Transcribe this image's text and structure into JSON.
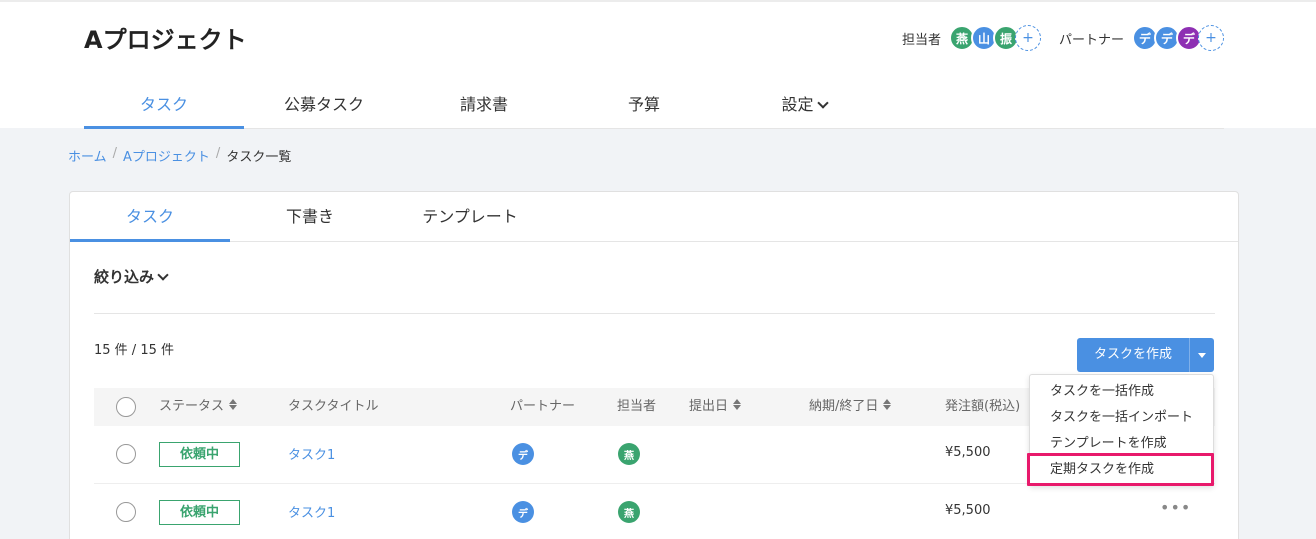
{
  "header": {
    "project_title": "Aプロジェクト",
    "assignee_label": "担当者",
    "partner_label": "パートナー",
    "assignees": [
      {
        "initial": "燕",
        "color": "#3aa46f"
      },
      {
        "initial": "山",
        "color": "#4a90e2"
      },
      {
        "initial": "振",
        "color": "#3aa46f"
      }
    ],
    "partners": [
      {
        "initial": "デ",
        "color": "#4a90e2"
      },
      {
        "initial": "デ",
        "color": "#4a90e2"
      },
      {
        "initial": "デ",
        "color": "#8e2fb3"
      }
    ],
    "add_symbol": "+"
  },
  "nav": {
    "items": [
      {
        "label": "タスク",
        "active": true
      },
      {
        "label": "公募タスク"
      },
      {
        "label": "請求書"
      },
      {
        "label": "予算"
      },
      {
        "label": "設定"
      }
    ]
  },
  "breadcrumb": {
    "home": "ホーム",
    "project": "Aプロジェクト",
    "current": "タスク一覧",
    "separator": "/"
  },
  "tabs": [
    {
      "label": "タスク",
      "active": true
    },
    {
      "label": "下書き"
    },
    {
      "label": "テンプレート"
    }
  ],
  "filter": {
    "label": "絞り込み"
  },
  "count": "15 件 / 15 件",
  "create": {
    "label": "タスクを作成",
    "menu": [
      "タスクを一括作成",
      "タスクを一括インポート",
      "テンプレートを作成",
      "定期タスクを作成"
    ]
  },
  "table": {
    "headers": {
      "status": "ステータス",
      "title": "タスクタイトル",
      "partner": "パートナー",
      "assignee": "担当者",
      "submit_date": "提出日",
      "due_date": "納期/終了日",
      "amount": "発注額(税込)"
    },
    "rows": [
      {
        "status": "依頼中",
        "title": "タスク1",
        "partner": "デ",
        "assignee": "燕",
        "amount": "¥5,500"
      },
      {
        "status": "依頼中",
        "title": "タスク1",
        "partner": "デ",
        "assignee": "燕",
        "amount": "¥5,500"
      }
    ],
    "more_symbol": "•••"
  },
  "colors": {
    "accent": "#4a90e2",
    "status_green": "#3aa46f",
    "highlight": "#e8196b"
  }
}
